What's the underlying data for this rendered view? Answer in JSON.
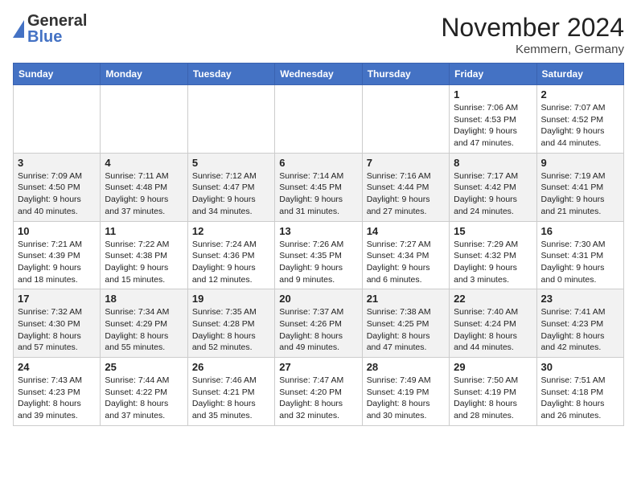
{
  "header": {
    "logo_general": "General",
    "logo_blue": "Blue",
    "month_title": "November 2024",
    "location": "Kemmern, Germany"
  },
  "weekdays": [
    "Sunday",
    "Monday",
    "Tuesday",
    "Wednesday",
    "Thursday",
    "Friday",
    "Saturday"
  ],
  "weeks": [
    [
      {
        "day": "",
        "info": ""
      },
      {
        "day": "",
        "info": ""
      },
      {
        "day": "",
        "info": ""
      },
      {
        "day": "",
        "info": ""
      },
      {
        "day": "",
        "info": ""
      },
      {
        "day": "1",
        "info": "Sunrise: 7:06 AM\nSunset: 4:53 PM\nDaylight: 9 hours and 47 minutes."
      },
      {
        "day": "2",
        "info": "Sunrise: 7:07 AM\nSunset: 4:52 PM\nDaylight: 9 hours and 44 minutes."
      }
    ],
    [
      {
        "day": "3",
        "info": "Sunrise: 7:09 AM\nSunset: 4:50 PM\nDaylight: 9 hours and 40 minutes."
      },
      {
        "day": "4",
        "info": "Sunrise: 7:11 AM\nSunset: 4:48 PM\nDaylight: 9 hours and 37 minutes."
      },
      {
        "day": "5",
        "info": "Sunrise: 7:12 AM\nSunset: 4:47 PM\nDaylight: 9 hours and 34 minutes."
      },
      {
        "day": "6",
        "info": "Sunrise: 7:14 AM\nSunset: 4:45 PM\nDaylight: 9 hours and 31 minutes."
      },
      {
        "day": "7",
        "info": "Sunrise: 7:16 AM\nSunset: 4:44 PM\nDaylight: 9 hours and 27 minutes."
      },
      {
        "day": "8",
        "info": "Sunrise: 7:17 AM\nSunset: 4:42 PM\nDaylight: 9 hours and 24 minutes."
      },
      {
        "day": "9",
        "info": "Sunrise: 7:19 AM\nSunset: 4:41 PM\nDaylight: 9 hours and 21 minutes."
      }
    ],
    [
      {
        "day": "10",
        "info": "Sunrise: 7:21 AM\nSunset: 4:39 PM\nDaylight: 9 hours and 18 minutes."
      },
      {
        "day": "11",
        "info": "Sunrise: 7:22 AM\nSunset: 4:38 PM\nDaylight: 9 hours and 15 minutes."
      },
      {
        "day": "12",
        "info": "Sunrise: 7:24 AM\nSunset: 4:36 PM\nDaylight: 9 hours and 12 minutes."
      },
      {
        "day": "13",
        "info": "Sunrise: 7:26 AM\nSunset: 4:35 PM\nDaylight: 9 hours and 9 minutes."
      },
      {
        "day": "14",
        "info": "Sunrise: 7:27 AM\nSunset: 4:34 PM\nDaylight: 9 hours and 6 minutes."
      },
      {
        "day": "15",
        "info": "Sunrise: 7:29 AM\nSunset: 4:32 PM\nDaylight: 9 hours and 3 minutes."
      },
      {
        "day": "16",
        "info": "Sunrise: 7:30 AM\nSunset: 4:31 PM\nDaylight: 9 hours and 0 minutes."
      }
    ],
    [
      {
        "day": "17",
        "info": "Sunrise: 7:32 AM\nSunset: 4:30 PM\nDaylight: 8 hours and 57 minutes."
      },
      {
        "day": "18",
        "info": "Sunrise: 7:34 AM\nSunset: 4:29 PM\nDaylight: 8 hours and 55 minutes."
      },
      {
        "day": "19",
        "info": "Sunrise: 7:35 AM\nSunset: 4:28 PM\nDaylight: 8 hours and 52 minutes."
      },
      {
        "day": "20",
        "info": "Sunrise: 7:37 AM\nSunset: 4:26 PM\nDaylight: 8 hours and 49 minutes."
      },
      {
        "day": "21",
        "info": "Sunrise: 7:38 AM\nSunset: 4:25 PM\nDaylight: 8 hours and 47 minutes."
      },
      {
        "day": "22",
        "info": "Sunrise: 7:40 AM\nSunset: 4:24 PM\nDaylight: 8 hours and 44 minutes."
      },
      {
        "day": "23",
        "info": "Sunrise: 7:41 AM\nSunset: 4:23 PM\nDaylight: 8 hours and 42 minutes."
      }
    ],
    [
      {
        "day": "24",
        "info": "Sunrise: 7:43 AM\nSunset: 4:23 PM\nDaylight: 8 hours and 39 minutes."
      },
      {
        "day": "25",
        "info": "Sunrise: 7:44 AM\nSunset: 4:22 PM\nDaylight: 8 hours and 37 minutes."
      },
      {
        "day": "26",
        "info": "Sunrise: 7:46 AM\nSunset: 4:21 PM\nDaylight: 8 hours and 35 minutes."
      },
      {
        "day": "27",
        "info": "Sunrise: 7:47 AM\nSunset: 4:20 PM\nDaylight: 8 hours and 32 minutes."
      },
      {
        "day": "28",
        "info": "Sunrise: 7:49 AM\nSunset: 4:19 PM\nDaylight: 8 hours and 30 minutes."
      },
      {
        "day": "29",
        "info": "Sunrise: 7:50 AM\nSunset: 4:19 PM\nDaylight: 8 hours and 28 minutes."
      },
      {
        "day": "30",
        "info": "Sunrise: 7:51 AM\nSunset: 4:18 PM\nDaylight: 8 hours and 26 minutes."
      }
    ]
  ]
}
